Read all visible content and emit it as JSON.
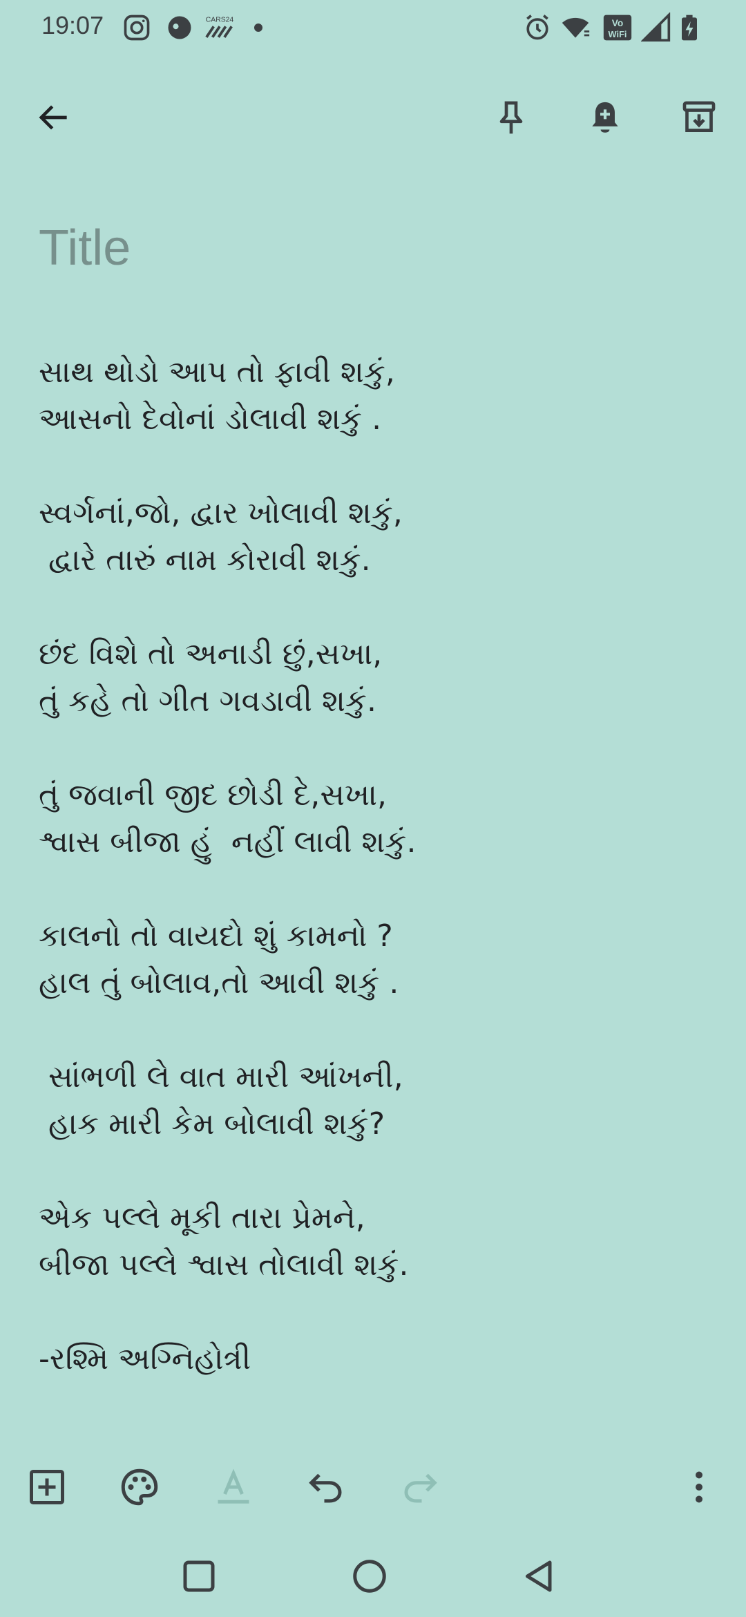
{
  "status_bar": {
    "time": "19:07",
    "carrier_badge": "CARS24",
    "network_badge": "Vo⁾ WiFi"
  },
  "note": {
    "title_placeholder": "Title",
    "stanzas": [
      [
        "સાથ થોડો આપ તો ફાવી શકું,",
        "આસનો દેવોનાં ડોલાવી શકું ."
      ],
      [
        "સ્વર્ગનાં,જો, દ્વાર ખોલાવી શકું,",
        " દ્વારે તારું નામ કોરાવી શકું."
      ],
      [
        "છંદ વિશે તો અનાડી છું,સખા,",
        "તું કહે તો ગીત ગવડાવી શકું."
      ],
      [
        "તું જવાની જીદ છોડી દે,સખા,",
        "શ્વાસ બીજા હું  નહીં લાવી શકું."
      ],
      [
        "કાલનો તો વાયદો શું કામનો ?",
        "હાલ તું બોલાવ,તો આવી શકું ."
      ],
      [
        " સાંભળી લે વાત મારી આંખની,",
        " હાક મારી કેમ બોલાવી શકું?"
      ],
      [
        "એક પલ્લે મૂકી તારા પ્રેમને,",
        "બીજા પલ્લે શ્વાસ તોલાવી શકું."
      ],
      [
        "-રશ્મિ અગ્નિહોત્રી"
      ]
    ]
  },
  "colors": {
    "background": "#b4ded6",
    "icon": "#3c4043",
    "text": "#202124",
    "placeholder": "#77908c",
    "disabled_icon": "#8fbfb6"
  },
  "icons": {
    "back": "arrow-left-icon",
    "pin": "pin-icon",
    "reminder": "bell-plus-icon",
    "archive": "archive-icon",
    "add": "add-box-icon",
    "palette": "palette-icon",
    "text_format": "text-format-icon",
    "undo": "undo-icon",
    "redo": "redo-icon",
    "more": "more-vert-icon"
  }
}
